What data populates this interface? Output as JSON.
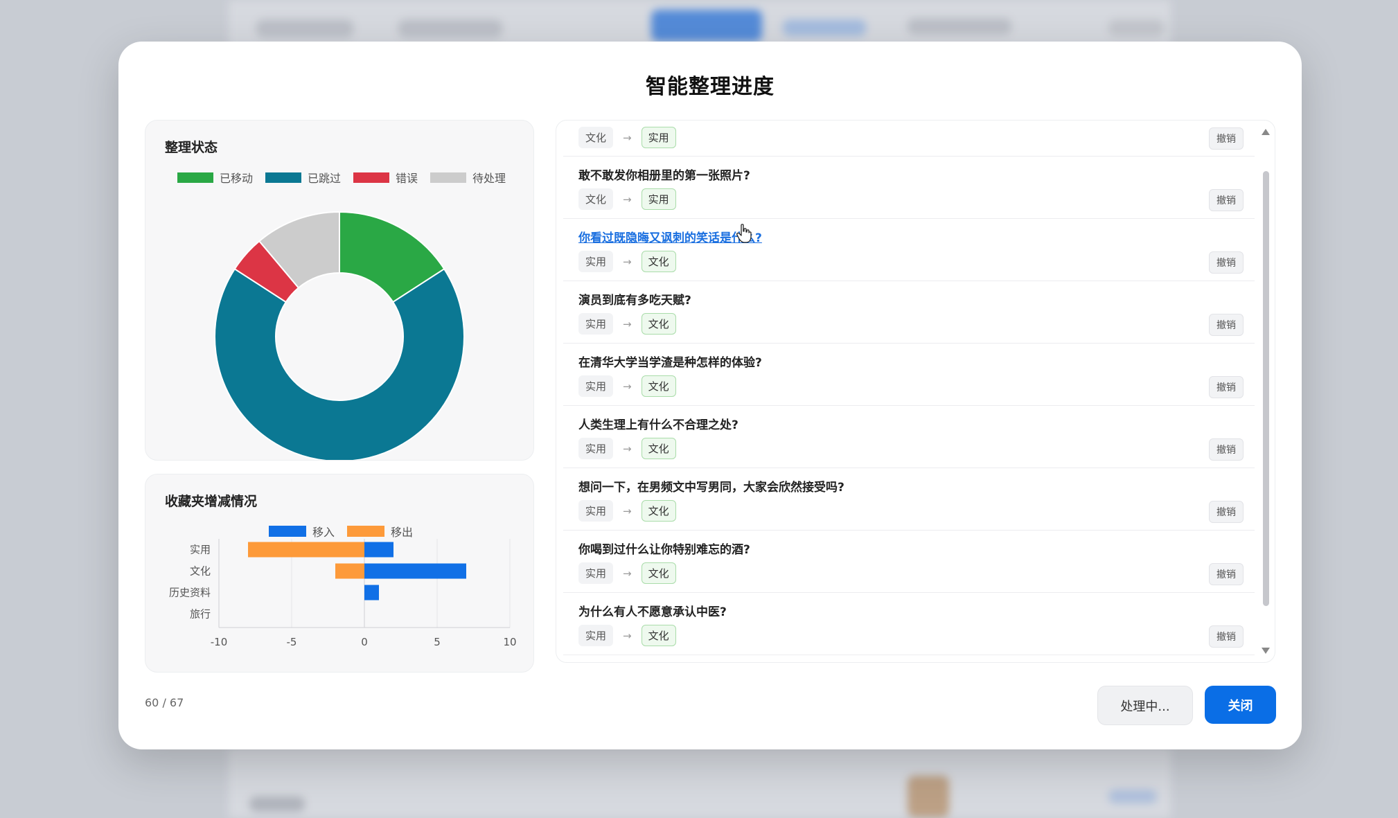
{
  "modal": {
    "title": "智能整理进度",
    "count": "60 / 67",
    "processing_label": "处理中...",
    "close_label": "关闭"
  },
  "status_panel": {
    "title": "整理状态",
    "legend": [
      {
        "label": "已移动",
        "color": "#2aa845"
      },
      {
        "label": "已跳过",
        "color": "#0b7893"
      },
      {
        "label": "错误",
        "color": "#dc3545"
      },
      {
        "label": "待处理",
        "color": "#cccccc"
      }
    ]
  },
  "folder_panel": {
    "title": "收藏夹增减情况",
    "legend": [
      {
        "label": "移入",
        "color": "#1170e6"
      },
      {
        "label": "移出",
        "color": "#fd9a3a"
      }
    ]
  },
  "chart_data": [
    {
      "type": "pie",
      "variant": "donut",
      "labels": [
        "已移动",
        "已跳过",
        "错误",
        "待处理"
      ],
      "values": [
        10,
        43,
        3,
        7
      ],
      "colors": [
        "#2aa845",
        "#0b7893",
        "#dc3545",
        "#cccccc"
      ],
      "legend": "top"
    },
    {
      "type": "bar",
      "orientation": "horizontal",
      "stacked": true,
      "categories": [
        "实用",
        "文化",
        "历史资料",
        "旅行"
      ],
      "series": [
        {
          "name": "移入",
          "values": [
            2,
            7,
            1,
            0
          ],
          "color": "#1170e6"
        },
        {
          "name": "移出",
          "values": [
            -8,
            -2,
            0,
            0
          ],
          "color": "#fd9a3a"
        }
      ],
      "xlim": [
        -10,
        10
      ],
      "xticks": [
        "-10",
        "-5",
        "0",
        "5",
        "10"
      ],
      "grid": true,
      "legend": "top"
    }
  ],
  "list": {
    "undo_label": "撤销",
    "arrow": "→",
    "items": [
      {
        "title": "",
        "from": "文化",
        "to": "实用"
      },
      {
        "title": "敢不敢发你相册里的第一张照片?",
        "from": "文化",
        "to": "实用"
      },
      {
        "title": "你看过既隐晦又讽刺的笑话是什么?",
        "from": "实用",
        "to": "文化"
      },
      {
        "title": "演员到底有多吃天赋?",
        "from": "实用",
        "to": "文化"
      },
      {
        "title": "在清华大学当学渣是种怎样的体验?",
        "from": "实用",
        "to": "文化"
      },
      {
        "title": "人类生理上有什么不合理之处?",
        "from": "实用",
        "to": "文化"
      },
      {
        "title": "想问一下，在男频文中写男同，大家会欣然接受吗?",
        "from": "实用",
        "to": "文化"
      },
      {
        "title": "你喝到过什么让你特别难忘的酒?",
        "from": "实用",
        "to": "文化"
      },
      {
        "title": "为什么有人不愿意承认中医?",
        "from": "实用",
        "to": "文化"
      }
    ]
  }
}
